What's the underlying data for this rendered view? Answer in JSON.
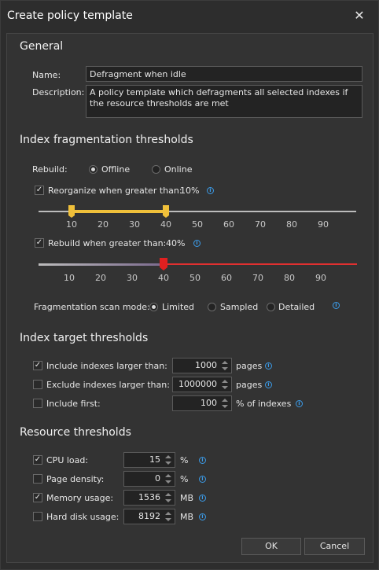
{
  "window": {
    "title": "Create policy template"
  },
  "general": {
    "heading": "General",
    "name_label": "Name:",
    "name_value": "Defragment when idle",
    "description_label": "Description:",
    "description_value": "A policy template which defragments all selected indexes if the resource thresholds are met"
  },
  "fragmentation": {
    "heading": "Index fragmentation thresholds",
    "rebuild_label": "Rebuild:",
    "rebuild_options": [
      "Offline",
      "Online"
    ],
    "rebuild_selected": "Offline",
    "reorganize_label": "Reorganize when greater than:",
    "reorganize_checked": true,
    "reorganize_value": "10%",
    "reorganize_range_percent": [
      10,
      40
    ],
    "rebuild_when_label": "Rebuild when greater than:",
    "rebuild_checked": true,
    "rebuild_value": "40%",
    "rebuild_threshold_percent": 40,
    "ticks": [
      "10",
      "20",
      "30",
      "40",
      "50",
      "60",
      "70",
      "80",
      "90"
    ],
    "scan_mode_label": "Fragmentation scan mode:",
    "scan_modes": [
      "Limited",
      "Sampled",
      "Detailed"
    ],
    "scan_selected": "Limited",
    "colors": {
      "reorganize_range": "#f0c03a",
      "rebuild_range": "#e03030",
      "rebuild_handle": "#e02020"
    }
  },
  "target": {
    "heading": "Index target thresholds",
    "rows": [
      {
        "label": "Include indexes larger than:",
        "checked": true,
        "value": "1000",
        "unit": "pages"
      },
      {
        "label": "Exclude indexes larger than:",
        "checked": false,
        "value": "1000000",
        "unit": "pages"
      },
      {
        "label": "Include first:",
        "checked": false,
        "value": "100",
        "unit": "% of indexes"
      }
    ]
  },
  "resource": {
    "heading": "Resource thresholds",
    "rows": [
      {
        "label": "CPU load:",
        "checked": true,
        "value": "15",
        "unit": "%"
      },
      {
        "label": "Page density:",
        "checked": false,
        "value": "0",
        "unit": "%"
      },
      {
        "label": "Memory usage:",
        "checked": true,
        "value": "1536",
        "unit": "MB"
      },
      {
        "label": "Hard disk usage:",
        "checked": false,
        "value": "8192",
        "unit": "MB"
      }
    ]
  },
  "buttons": {
    "ok": "OK",
    "cancel": "Cancel"
  },
  "icons": {
    "close": "close-icon",
    "info": "info-icon",
    "check": "checkmark-icon"
  }
}
